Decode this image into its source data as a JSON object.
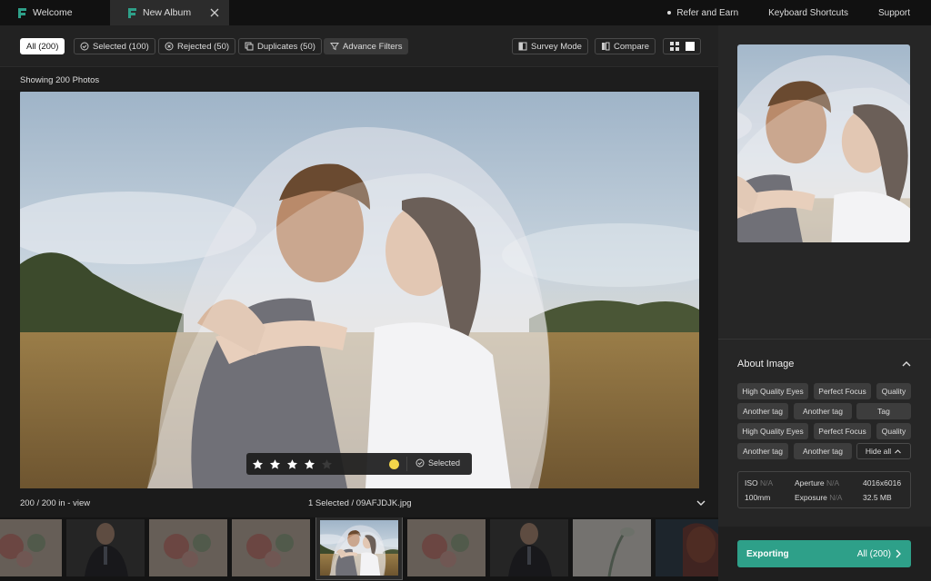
{
  "tabs": {
    "welcome": "Welcome",
    "album": "New Album"
  },
  "top_links": {
    "refer": "Refer and Earn",
    "shortcuts": "Keyboard Shortcuts",
    "support": "Support"
  },
  "filters": {
    "all": "All (200)",
    "selected": "Selected (100)",
    "rejected": "Rejected (50)",
    "duplicates": "Duplicates (50)",
    "advance": "Advance Filters"
  },
  "tools": {
    "survey": "Survey Mode",
    "compare": "Compare"
  },
  "showing": "Showing 200 Photos",
  "rating": {
    "stars": 4,
    "max_stars": 5,
    "color_label": "#f3d64a",
    "status": "Selected"
  },
  "status": {
    "count": "200 / 200 in - view",
    "selection": "1 Selected / 09AFJDJK.jpg"
  },
  "about": {
    "title": "About Image",
    "tags_row1": [
      "High Quality Eyes",
      "Perfect Focus",
      "Quality"
    ],
    "tags_row2": [
      "Another tag",
      "Another tag",
      "Tag"
    ],
    "tags_row3": [
      "High Quality Eyes",
      "Perfect Focus",
      "Quality"
    ],
    "tags_row4": [
      "Another tag",
      "Another tag"
    ],
    "hide_all": "Hide all"
  },
  "meta": {
    "iso_label": "ISO",
    "iso_value": "N/A",
    "aperture_label": "Aperture",
    "aperture_value": "N/A",
    "resolution": "4016x6016",
    "focal": "100mm",
    "exposure_label": "Exposure",
    "exposure_value": "N/A",
    "size": "32.5 MB"
  },
  "export": {
    "label": "Exporting",
    "scope": "All (200)"
  },
  "colors": {
    "accent": "#2ea089",
    "label_yellow": "#f3d64a"
  }
}
